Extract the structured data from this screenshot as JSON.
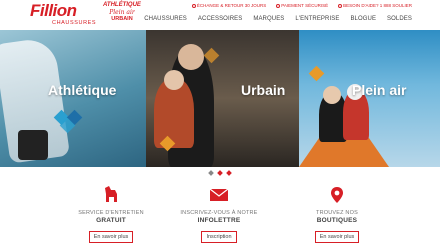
{
  "brand": {
    "name": "Fillion",
    "tagline": "CHAUSSURES"
  },
  "sublogo": {
    "line1": "ATHLÉTIQUE",
    "line2": "Plein air",
    "line3": "URBAIN"
  },
  "utility_nav": [
    {
      "label": "ÉCHANGE & RETOUR 30 JOURS",
      "icon": "refresh-icon"
    },
    {
      "label": "PAIEMENT SÉCURISÉ",
      "icon": "credit-card-icon"
    },
    {
      "label": "BESOIN D'AIDE? 1 888 SOULIER",
      "icon": "phone-icon"
    }
  ],
  "main_nav": [
    "CHAUSSURES",
    "ACCESSOIRES",
    "MARQUES",
    "L'ENTREPRISE",
    "BLOGUE",
    "SOLDES"
  ],
  "hero": {
    "panels": [
      {
        "label": "Athlétique"
      },
      {
        "label": "Urbain"
      },
      {
        "label": "Plein air"
      }
    ]
  },
  "features": [
    {
      "icon": "dog-icon",
      "line1": "SERVICE D'ENTRETIEN",
      "line2": "GRATUIT",
      "button": "En savoir plus"
    },
    {
      "icon": "envelope-icon",
      "line1": "INSCRIVEZ-VOUS À NOTRE",
      "line2": "INFOLETTRE",
      "button": "Inscription"
    },
    {
      "icon": "map-pin-icon",
      "line1": "TROUVEZ NOS",
      "line2": "BOUTIQUES",
      "button": "En savoir plus"
    }
  ],
  "colors": {
    "accent": "#d71f26",
    "diamond_blue": "#2aa0d0",
    "diamond_orange": "#e89a2a"
  }
}
